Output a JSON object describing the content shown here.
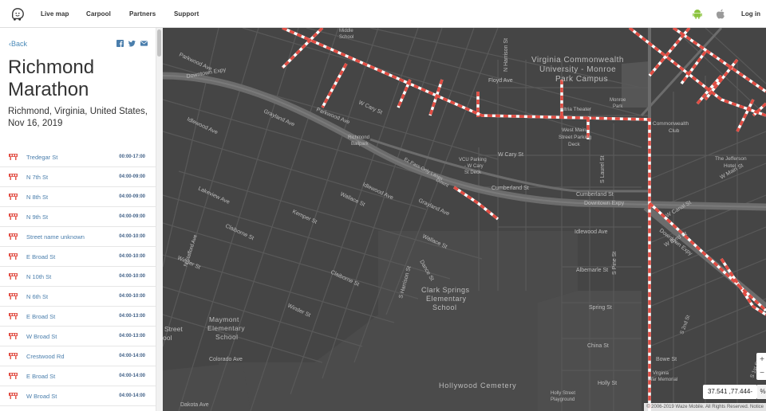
{
  "topbar": {
    "nav": [
      "Live map",
      "Carpool",
      "Partners",
      "Support"
    ],
    "login_label": "Log in",
    "android_color": "#8cc43f",
    "apple_color": "#9a9a9a"
  },
  "sidebar": {
    "back_label": "Back",
    "event_title": "Richmond Marathon",
    "event_subtitle": "Richmond, Virginia, United States, Nov 16, 2019",
    "share_icons": [
      "facebook-icon",
      "twitter-icon",
      "email-icon"
    ],
    "closure_icon_color": "#e14d43",
    "closures": [
      {
        "street": "Tredegar St",
        "time": "00:00-17:00"
      },
      {
        "street": "N 7th St",
        "time": "04:00-09:00"
      },
      {
        "street": "N 8th St",
        "time": "04:00-09:00"
      },
      {
        "street": "N 9th St",
        "time": "04:00-09:00"
      },
      {
        "street": "Street name unknown",
        "time": "04:00-10:00"
      },
      {
        "street": "E Broad St",
        "time": "04:00-10:00"
      },
      {
        "street": "N 10th St",
        "time": "04:00-10:00"
      },
      {
        "street": "N 6th St",
        "time": "04:00-10:00"
      },
      {
        "street": "E Broad St",
        "time": "04:00-13:00"
      },
      {
        "street": "W Broad St",
        "time": "04:00-13:00"
      },
      {
        "street": "Crestwood Rd",
        "time": "04:00-14:00"
      },
      {
        "street": "E Broad St",
        "time": "04:00-14:00"
      },
      {
        "street": "W Broad St",
        "time": "04:00-14:00"
      }
    ]
  },
  "map": {
    "closure_color": "#e14d43",
    "labels": {
      "vcu": "Virginia Commonwealth",
      "vcu2": "University - Monroe",
      "vcu3": "Park Campus",
      "clark1": "Clark Springs",
      "clark2": "Elementary",
      "clark3": "School",
      "maymont1": "Maymont",
      "maymont2": "Elementary",
      "maymont3": "School",
      "street1": "Street",
      "street2": "ool",
      "hollywood": "Hollywood Cemetery",
      "downtown1": "Downtown Expy",
      "downtown2": "Downtown Expy",
      "downtown3": "Downtown Expy",
      "wcary": "W Cary St",
      "wcary2": "W Cary St",
      "cumberland": "Cumberland St",
      "cumberland2": "Cumberland St",
      "idlewood": "Idlewood Ave",
      "idlewood2": "Idlewood Ave",
      "idlewood3": "Idlewood Ave",
      "parkwood": "Parkwood Ave",
      "parkwood2": "Parkwood Ave",
      "grayland": "Grayland Ave",
      "grayland2": "Grayland Ave",
      "floyd": "Floyd Ave",
      "lakeview": "Lakeview Ave",
      "claiborne": "Claiborne St",
      "claiborne2": "Claiborne St",
      "winder": "Winder St",
      "winder2": "Winder St",
      "colorado": "Colorado Ave",
      "dakota": "Dakota Ave",
      "spring": "Spring St",
      "albemarle": "Albemarle St",
      "china": "China St",
      "hollyst": "Holly St",
      "bowe": "Bowe St",
      "wallace": "Wallace St",
      "wallace2": "Wallace St",
      "kemper": "Kemper St",
      "laurel": "S Laurel St",
      "pine": "S Pine St",
      "harrison": "N Harrison St",
      "harrison2": "S Harrison St",
      "dance": "Dance St",
      "commonwealth1": "Commonwealth",
      "commonwealth2": "Club",
      "jefferson1": "The Jefferson",
      "jefferson2": "Hotel",
      "wmain": "W Main St",
      "wcanal": "W Canal St",
      "wbyrd": "W Byrd St",
      "monroe1": "Monroe",
      "monroe2": "Park",
      "altria": "Altria Theater",
      "deck1": "West Main",
      "deck2": "Street Parking",
      "deck3": "Deck",
      "vcudeck1": "VCU Parking",
      "vcudeck2": "- W Cary",
      "vcudeck3": "St Deck",
      "richmond1": "Richmond",
      "richmond2": "Ballpark",
      "middle1": "Middle",
      "middle2": "School",
      "vwm1": "Virginia",
      "vwm2": "War Memorial",
      "hollywoodpg1": "Holly Street",
      "hollywoodpg2": "Playground",
      "expylanes": "Ez Pass Only Lanes",
      "sdoor": "Downt",
      "s2nd": "S 2nd St",
      "stafford": "N Stafford Ave",
      "s1st": "S 1st St"
    },
    "coords": "37.541 ,77.444-",
    "coords_btn": "%",
    "zoom_in": "+",
    "zoom_out": "−",
    "copyright": "© 2006-2019 Waze Mobile. All Rights Reserved. Notice"
  }
}
